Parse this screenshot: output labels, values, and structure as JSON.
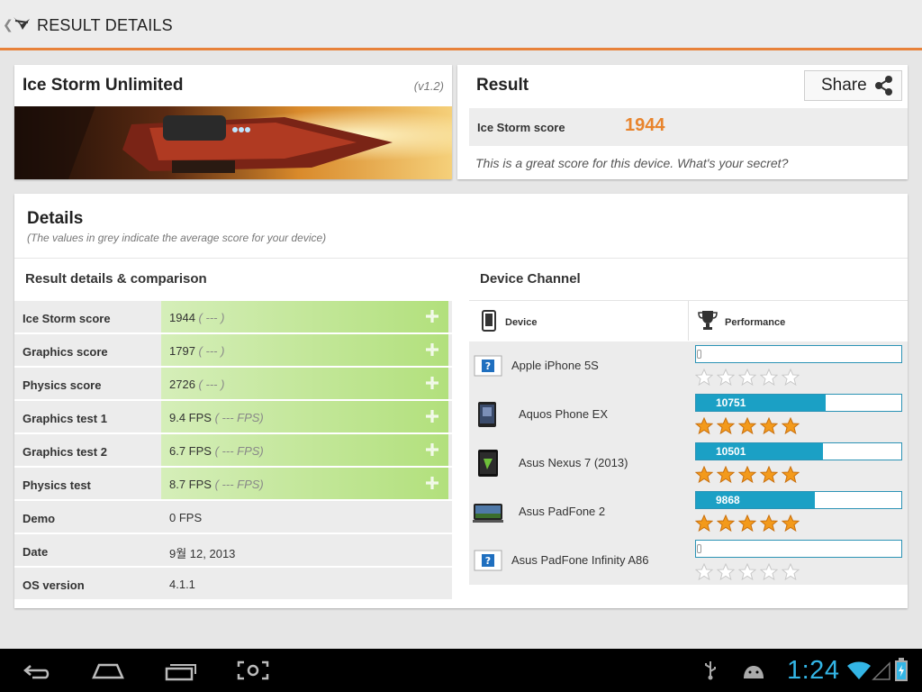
{
  "action_bar": {
    "title": "RESULT DETAILS",
    "up_icon": "chevron-left-icon",
    "logo_icon": "3dmark-logo-icon"
  },
  "test": {
    "name": "Ice Storm Unlimited",
    "version": "(v1.2)"
  },
  "result": {
    "title": "Result",
    "share_label": "Share",
    "score_label": "Ice Storm score",
    "score_value": "1944",
    "message": "This is a great score for this device. What's your secret?"
  },
  "details": {
    "title": "Details",
    "note": "(The values in grey indicate the average score for your device)",
    "comparison_title": "Result details & comparison",
    "rows": [
      {
        "label": "Ice Storm score",
        "value": "1944",
        "avg": "( --- )",
        "expandable": true
      },
      {
        "label": "Graphics score",
        "value": "1797",
        "avg": "( --- )",
        "expandable": true
      },
      {
        "label": "Physics score",
        "value": "2726",
        "avg": "( --- )",
        "expandable": true
      },
      {
        "label": "Graphics test 1",
        "value": "9.4 FPS",
        "avg": "( --- FPS)",
        "expandable": true
      },
      {
        "label": "Graphics test 2",
        "value": "6.7 FPS",
        "avg": "( --- FPS)",
        "expandable": true
      },
      {
        "label": "Physics test",
        "value": "8.7 FPS",
        "avg": "( --- FPS)",
        "expandable": true
      },
      {
        "label": "Demo",
        "value": "0 FPS",
        "avg": "",
        "expandable": false
      },
      {
        "label": "Date",
        "value": "9월 12, 2013",
        "avg": "",
        "expandable": false
      },
      {
        "label": "OS version",
        "value": "4.1.1",
        "avg": "",
        "expandable": false
      }
    ]
  },
  "device_channel": {
    "title": "Device Channel",
    "col_device": "Device",
    "col_performance": "Performance",
    "max_score": 17000,
    "devices": [
      {
        "name": "Apple iPhone 5S",
        "score": "",
        "score_num": 0,
        "stars": 0,
        "thumb": "unknown-device-icon"
      },
      {
        "name": "Aquos Phone EX",
        "score": "10751",
        "score_num": 10751,
        "stars": 5,
        "thumb": "phone-thumbnail"
      },
      {
        "name": "Asus Nexus 7 (2013)",
        "score": "10501",
        "score_num": 10501,
        "stars": 5,
        "thumb": "tablet-thumbnail"
      },
      {
        "name": "Asus PadFone 2",
        "score": "9868",
        "score_num": 9868,
        "stars": 5,
        "thumb": "padfone-thumbnail"
      },
      {
        "name": "Asus PadFone Infinity A86",
        "score": "",
        "score_num": 0,
        "stars": 0,
        "thumb": "unknown-device-icon"
      }
    ]
  },
  "system_bar": {
    "time": "1:24",
    "icons": [
      "back-icon",
      "home-icon",
      "recent-apps-icon",
      "screenshot-icon",
      "usb-icon",
      "android-debug-icon",
      "wifi-icon",
      "signal-icon",
      "battery-icon"
    ]
  },
  "colors": {
    "accent": "#e8823a",
    "score": "#e8842d",
    "bar": "#1ba0c5",
    "green": "#b2e07c",
    "clock": "#33b5e5"
  }
}
